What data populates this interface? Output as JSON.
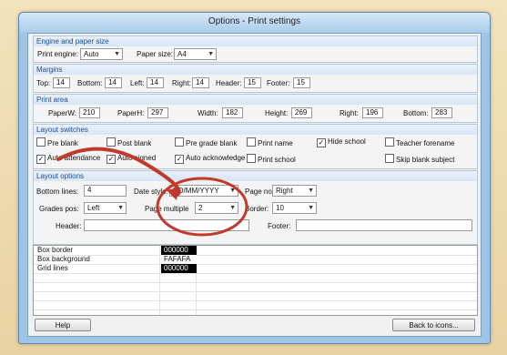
{
  "window": {
    "title": "Options - Print settings"
  },
  "engine": {
    "header": "Engine and paper size",
    "print_engine_label": "Print engine:",
    "print_engine_value": "Auto",
    "paper_size_label": "Paper size:",
    "paper_size_value": "A4"
  },
  "margins": {
    "header": "Margins",
    "top_label": "Top:",
    "top": "14",
    "bottom_label": "Bottom:",
    "bottom": "14",
    "left_label": "Left:",
    "left": "14",
    "right_label": "Right:",
    "right": "14",
    "header_label": "Header:",
    "header_value": "15",
    "footer_label": "Footer:",
    "footer": "15"
  },
  "print_area": {
    "header": "Print area",
    "paperw_label": "PaperW:",
    "paperw": "210",
    "paperh_label": "PaperH:",
    "paperh": "297",
    "width_label": "Width:",
    "width": "182",
    "height_label": "Height:",
    "height": "269",
    "right_label": "Right:",
    "right": "196",
    "bottom_label": "Bottom:",
    "bottom": "283"
  },
  "switches": {
    "header": "Layout switches",
    "items": [
      {
        "label": "Pre blank",
        "checked": false
      },
      {
        "label": "Post blank",
        "checked": false
      },
      {
        "label": "Pre grade blank",
        "checked": false
      },
      {
        "label": "Print name",
        "checked": false
      },
      {
        "label": "Hide school",
        "checked": true
      },
      {
        "label": "Teacher forename",
        "checked": false
      },
      {
        "label": "Auto attendance",
        "checked": true
      },
      {
        "label": "Auto signed",
        "checked": true
      },
      {
        "label": "Auto acknowledge",
        "checked": true
      },
      {
        "label": "Print school",
        "checked": false
      },
      {
        "label": "Skip blank subject",
        "checked": false
      }
    ]
  },
  "layout": {
    "header": "Layout options",
    "bottom_lines_label": "Bottom lines:",
    "bottom_lines": "4",
    "date_style_label": "Date style:",
    "date_style": "DD/MM/YYYY",
    "page_no_label": "Page no:",
    "page_no": "Right",
    "grades_pos_label": "Grades pos:",
    "grades_pos": "Left",
    "page_multiple_label": "Page multiple",
    "page_multiple": "2",
    "border_label": "Border:",
    "border": "10",
    "header_field_label": "Header:",
    "header_field": "",
    "footer_field_label": "Footer:",
    "footer_field": ""
  },
  "colours": [
    {
      "name": "Box border",
      "value": "000000"
    },
    {
      "name": "Box background",
      "value": "FAFAFA"
    },
    {
      "name": "Grid lines",
      "value": "000000"
    }
  ],
  "buttons": {
    "help": "Help",
    "back": "Back to icons..."
  },
  "accent": {
    "section_header_text": "#1a4d91",
    "annotation": "#c0392b",
    "swatch_dark": "#000000"
  }
}
